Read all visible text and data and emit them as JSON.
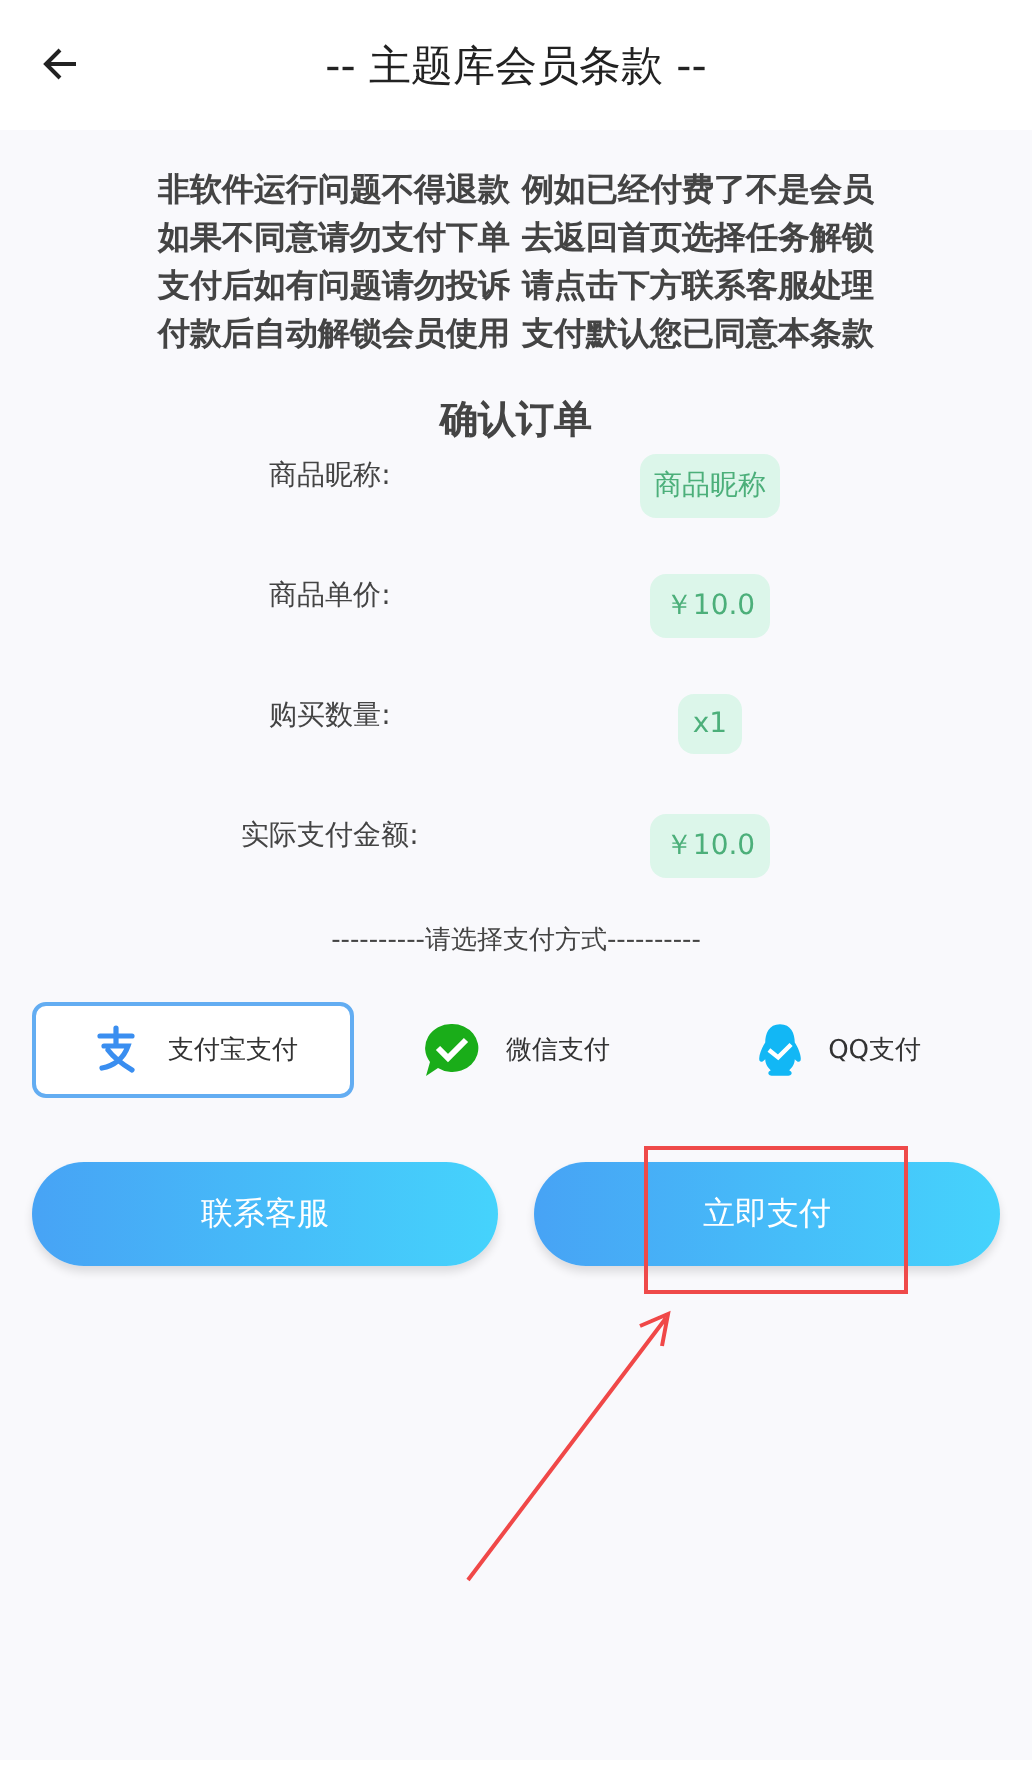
{
  "header": {
    "title": "-- 主题库会员条款 --"
  },
  "notice_lines": [
    "非软件运行问题不得退款 例如已经付费了不是会员",
    "如果不同意请勿支付下单 去返回首页选择任务解锁",
    "支付后如有问题请勿投诉 请点击下方联系客服处理",
    "付款后自动解锁会员使用 支付默认您已同意本条款"
  ],
  "order": {
    "title": "确认订单",
    "rows": [
      {
        "label": "商品昵称:",
        "value": "商品昵称"
      },
      {
        "label": "商品单价:",
        "value": "￥10.0"
      },
      {
        "label": "购买数量:",
        "value": "x1"
      },
      {
        "label": "实际支付金额:",
        "value": "￥10.0"
      }
    ]
  },
  "payment_prompt": "----------请选择支付方式----------",
  "payment_methods": [
    {
      "kind": "alipay",
      "label": "支付宝支付",
      "selected": true
    },
    {
      "kind": "wechat",
      "label": "微信支付",
      "selected": false
    },
    {
      "kind": "qq",
      "label": "QQ支付",
      "selected": false
    }
  ],
  "buttons": [
    {
      "label": "联系客服"
    },
    {
      "label": "立即支付"
    }
  ]
}
